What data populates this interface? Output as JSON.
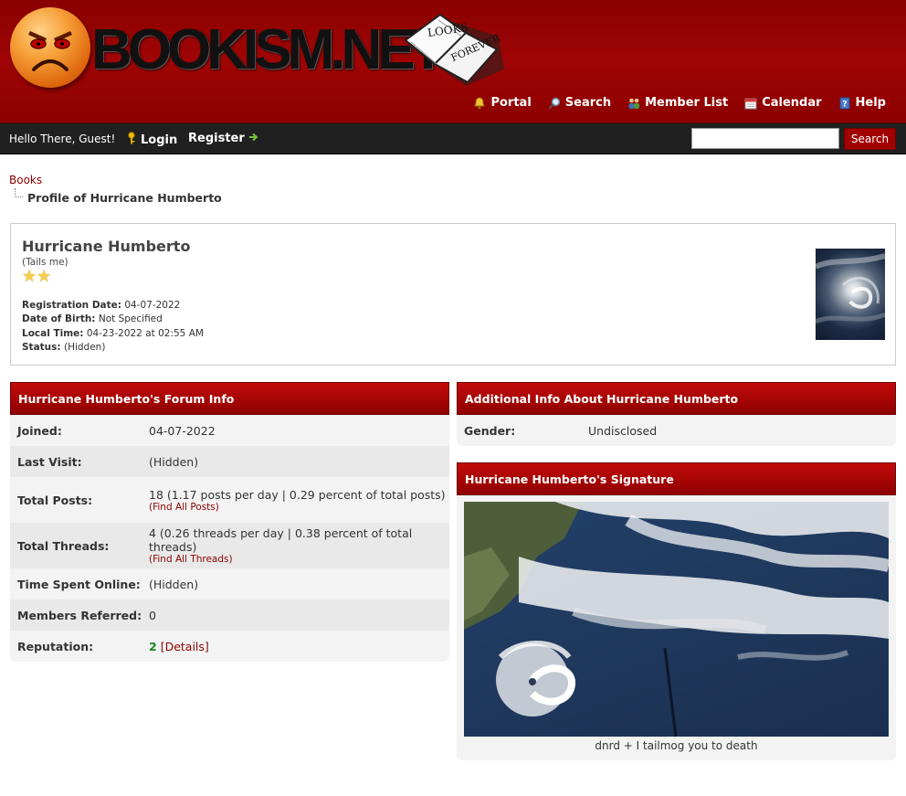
{
  "header": {
    "logo_text": "BOOKISM.NET",
    "logo_book_top": "LOOKS",
    "logo_book_bottom": "FOREVER",
    "nav": [
      {
        "label": "Portal",
        "icon": "bell-icon"
      },
      {
        "label": "Search",
        "icon": "magnifier-icon"
      },
      {
        "label": "Member List",
        "icon": "members-icon"
      },
      {
        "label": "Calendar",
        "icon": "calendar-icon"
      },
      {
        "label": "Help",
        "icon": "help-icon"
      }
    ]
  },
  "panel": {
    "greeting": "Hello There, Guest!",
    "login_label": "Login",
    "register_label": "Register",
    "search_value": "",
    "search_button": "Search"
  },
  "breadcrumb": {
    "root": "Books",
    "current": "Profile of Hurricane Humberto"
  },
  "profile": {
    "name": "Hurricane Humberto",
    "usertitle": "(Tails me)",
    "stars": 2,
    "registration_label": "Registration Date:",
    "registration_value": "04-07-2022",
    "dob_label": "Date of Birth:",
    "dob_value": "Not Specified",
    "localtime_label": "Local Time:",
    "localtime_value": "04-23-2022 at 02:55 AM",
    "status_label": "Status:",
    "status_value": "(Hidden)"
  },
  "forum_info": {
    "title": "Hurricane Humberto's Forum Info",
    "rows": [
      {
        "label": "Joined:",
        "value": "04-07-2022"
      },
      {
        "label": "Last Visit:",
        "value": "(Hidden)"
      },
      {
        "label": "Total Posts:",
        "value": "18 (1.17 posts per day | 0.29 percent of total posts)",
        "link": "Find All Posts"
      },
      {
        "label": "Total Threads:",
        "value": "4 (0.26 threads per day | 0.38 percent of total threads)",
        "link": "Find All Threads"
      },
      {
        "label": "Time Spent Online:",
        "value": "(Hidden)"
      },
      {
        "label": "Members Referred:",
        "value": "0"
      },
      {
        "label": "Reputation:",
        "value": "2",
        "link": "Details"
      }
    ]
  },
  "additional_info": {
    "title": "Additional Info About Hurricane Humberto",
    "gender_label": "Gender:",
    "gender_value": "Undisclosed"
  },
  "signature": {
    "title": "Hurricane Humberto's Signature",
    "text": "dnrd + I tailmog you to death"
  },
  "colors": {
    "header_red": "#a00505",
    "panel_dark": "#202020",
    "link_red": "#8b0000",
    "reputation_green": "#188a18"
  }
}
